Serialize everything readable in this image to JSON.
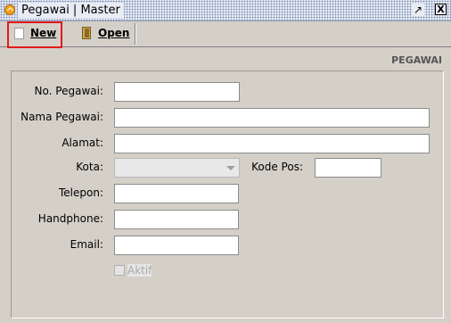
{
  "window": {
    "title": "Pegawai | Master",
    "min_icon": "restore-icon",
    "close_label": "X"
  },
  "toolbar": {
    "new_label": "New",
    "open_label": "Open",
    "highlight_color": "#e21b1b"
  },
  "form": {
    "section_title": "PEGAWAI",
    "fields": {
      "no_pegawai": {
        "label": "No. Pegawai:",
        "value": ""
      },
      "nama_pegawai": {
        "label": "Nama Pegawai:",
        "value": ""
      },
      "alamat": {
        "label": "Alamat:",
        "value": ""
      },
      "kota": {
        "label": "Kota:",
        "value": ""
      },
      "kode_pos": {
        "label": "Kode Pos:",
        "value": ""
      },
      "telepon": {
        "label": "Telepon:",
        "value": ""
      },
      "handphone": {
        "label": "Handphone:",
        "value": ""
      },
      "email": {
        "label": "Email:",
        "value": ""
      }
    },
    "aktif": {
      "label": "Aktif",
      "checked": false,
      "enabled": false
    }
  }
}
